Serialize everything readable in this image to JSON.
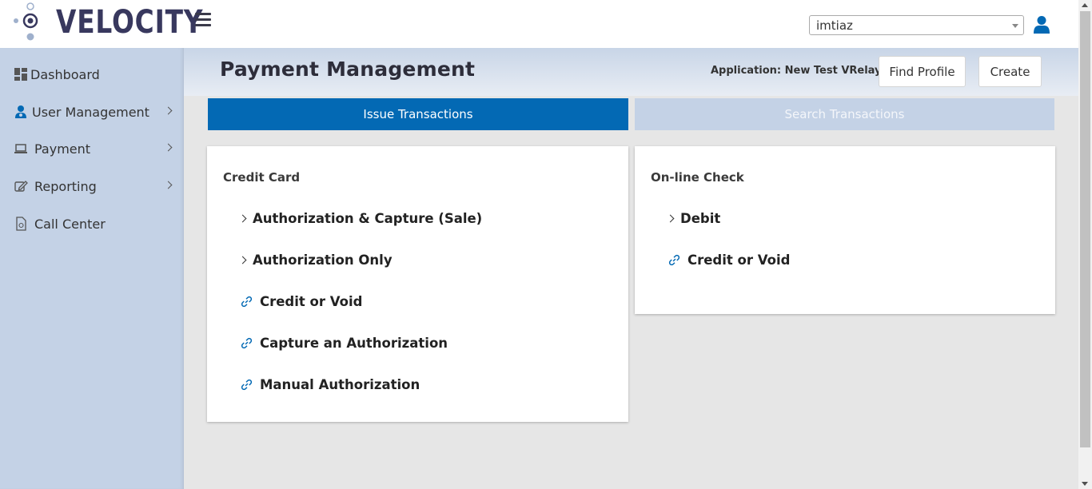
{
  "app": {
    "logo_text": "VELOCITY"
  },
  "topbar": {
    "user_select_value": "imtiaz"
  },
  "sidebar": {
    "items": [
      {
        "label": "Dashboard",
        "icon": "dashboard-icon"
      },
      {
        "label": "User Management",
        "icon": "users-icon",
        "expandable": true
      },
      {
        "label": "Payment",
        "icon": "laptop-icon",
        "expandable": true
      },
      {
        "label": "Reporting",
        "icon": "edit-icon",
        "expandable": true
      },
      {
        "label": "Call Center",
        "icon": "document-icon"
      }
    ]
  },
  "header": {
    "title": "Payment Management",
    "application_label": "Application: New Test VRelay",
    "find_profile_label": "Find Profile",
    "create_label": "Create"
  },
  "tabs": [
    {
      "label": "Issue Transactions",
      "active": true
    },
    {
      "label": "Search Transactions",
      "active": false
    }
  ],
  "credit_card": {
    "title": "Credit Card",
    "items": [
      {
        "label": "Authorization & Capture (Sale)",
        "icon": "chevron-right-icon"
      },
      {
        "label": "Authorization Only",
        "icon": "chevron-right-icon"
      },
      {
        "label": "Credit or Void",
        "icon": "link-icon"
      },
      {
        "label": "Capture an Authorization",
        "icon": "link-icon"
      },
      {
        "label": "Manual Authorization",
        "icon": "link-icon"
      }
    ]
  },
  "online_check": {
    "title": "On-line Check",
    "items": [
      {
        "label": "Debit",
        "icon": "chevron-right-icon"
      },
      {
        "label": "Credit or Void",
        "icon": "link-icon"
      }
    ]
  },
  "colors": {
    "primary": "#0369b4",
    "sidebar_bg": "#c4d2e6",
    "logo_text": "#38385e",
    "content_bg": "#e6e6e6"
  }
}
